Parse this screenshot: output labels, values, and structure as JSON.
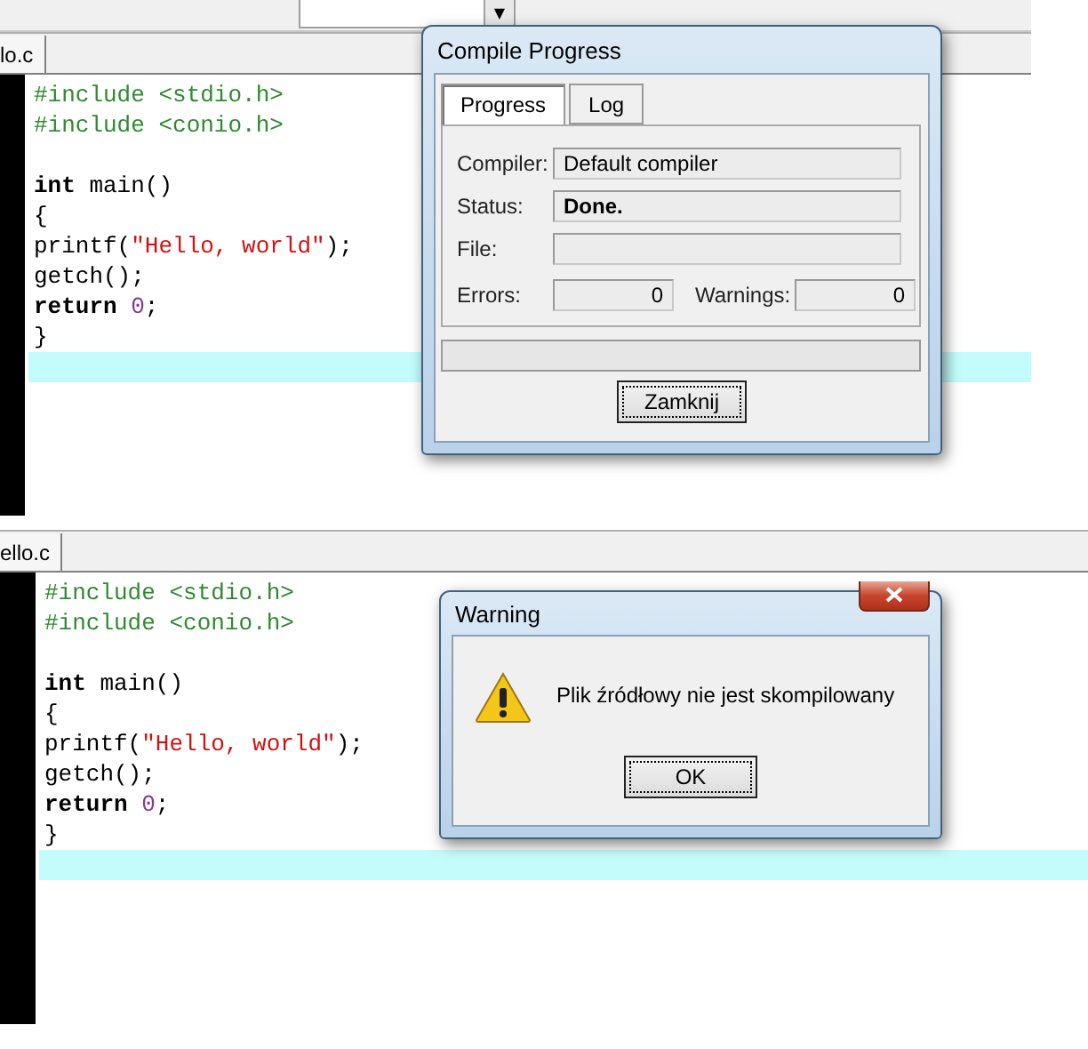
{
  "panels": [
    {
      "toolbar": {
        "combo_arrow": "▼"
      },
      "tab": {
        "label": "lo.c",
        "selected": true
      },
      "lines": [
        {
          "current": false,
          "tokens": [
            {
              "kind": "preprocessor",
              "text": "#include <stdio.h>"
            }
          ]
        },
        {
          "current": false,
          "tokens": [
            {
              "kind": "preprocessor",
              "text": "#include <conio.h>"
            }
          ]
        },
        {
          "current": false
        },
        {
          "current": false,
          "tokens": [
            {
              "kind": "keyword",
              "text": "int"
            },
            {
              "kind": "plain",
              "text": " main()"
            }
          ]
        },
        {
          "current": false,
          "tokens": [
            {
              "kind": "plain",
              "text": "{"
            }
          ]
        },
        {
          "current": false,
          "tokens": [
            {
              "kind": "plain",
              "text": "printf("
            },
            {
              "kind": "string",
              "text": "\"Hello, world\""
            },
            {
              "kind": "plain",
              "text": ");"
            }
          ]
        },
        {
          "current": false,
          "tokens": [
            {
              "kind": "plain",
              "text": "getch();"
            }
          ]
        },
        {
          "current": false,
          "tokens": [
            {
              "kind": "keyword",
              "text": "return "
            },
            {
              "kind": "number",
              "text": "0"
            },
            {
              "kind": "plain",
              "text": ";"
            }
          ]
        },
        {
          "current": false,
          "tokens": [
            {
              "kind": "plain",
              "text": "}"
            }
          ]
        },
        {
          "current": true
        }
      ],
      "dialog": {
        "kind": "compile_progress",
        "title": "Compile Progress",
        "tabs": [
          {
            "label": "Progress",
            "selected": true
          },
          {
            "label": "Log",
            "selected": false
          }
        ],
        "compiler_label": "Compiler:",
        "compiler": "Default compiler",
        "status_label": "Status:",
        "status": "Done.",
        "file_label": "File:",
        "errors_label": "Errors:",
        "errors": "0",
        "warnings_label": "Warnings:",
        "warnings": "0",
        "button": "Zamknij"
      }
    },
    {
      "tab": {
        "label": "ello.c",
        "selected": true
      },
      "lines": [
        {
          "current": false,
          "tokens": [
            {
              "kind": "preprocessor",
              "text": "#include <stdio.h>"
            }
          ]
        },
        {
          "current": false,
          "tokens": [
            {
              "kind": "preprocessor",
              "text": "#include <conio.h>"
            }
          ]
        },
        {
          "current": false
        },
        {
          "current": false,
          "tokens": [
            {
              "kind": "keyword",
              "text": "int"
            },
            {
              "kind": "plain",
              "text": " main()"
            }
          ]
        },
        {
          "current": false,
          "tokens": [
            {
              "kind": "plain",
              "text": "{"
            }
          ]
        },
        {
          "current": false,
          "tokens": [
            {
              "kind": "plain",
              "text": "printf("
            },
            {
              "kind": "string",
              "text": "\"Hello, world\""
            },
            {
              "kind": "plain",
              "text": ");"
            }
          ]
        },
        {
          "current": false,
          "tokens": [
            {
              "kind": "plain",
              "text": "getch();"
            }
          ]
        },
        {
          "current": false,
          "tokens": [
            {
              "kind": "keyword",
              "text": "return "
            },
            {
              "kind": "number",
              "text": "0"
            },
            {
              "kind": "plain",
              "text": ";"
            }
          ]
        },
        {
          "current": false,
          "tokens": [
            {
              "kind": "plain",
              "text": "}"
            }
          ]
        },
        {
          "current": true
        }
      ],
      "dialog": {
        "kind": "warning",
        "title": "Warning",
        "message": "Plik źródłowy nie jest skompilowany",
        "button": "OK"
      }
    }
  ]
}
